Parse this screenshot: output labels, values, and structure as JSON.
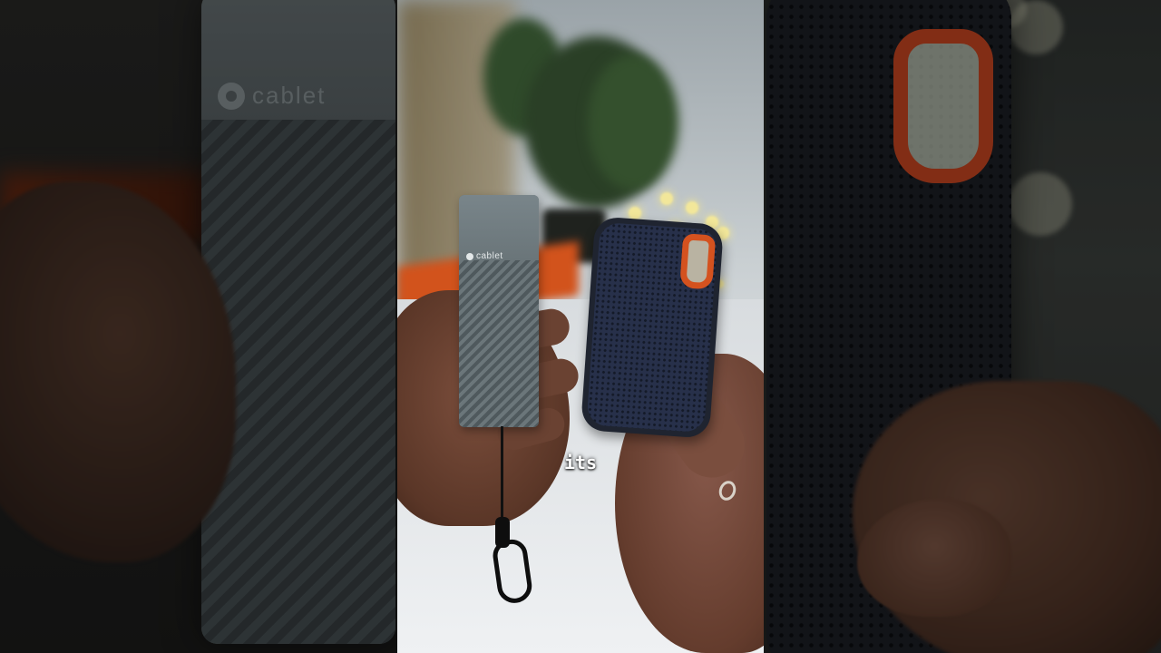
{
  "caption": {
    "text": "its"
  },
  "scene": {
    "left_panel_logo": "cablet",
    "center_device_left_logo": "cablet",
    "icons": [
      "cablet-logo-icon"
    ]
  },
  "colors": {
    "caption_text": "#ffffff",
    "sandisk_orange": "#d4521f",
    "cablet_gray": "#5f6a6e",
    "sandisk_navy": "#1f2430"
  }
}
